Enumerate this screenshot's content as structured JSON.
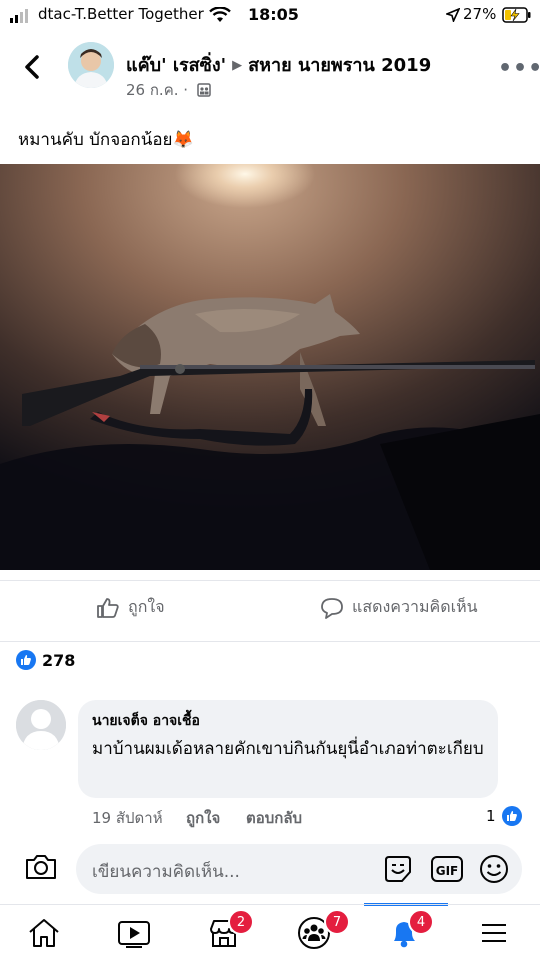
{
  "status_bar": {
    "carrier": "dtac-T.Better Together",
    "time": "18:05",
    "battery": "27%"
  },
  "header": {
    "author": "แค๊บ' เรสซิ่ง'",
    "group": "สหาย นายพราน 2019",
    "date": "26 ก.ค. ·",
    "colors": {
      "muted": "#65676b"
    }
  },
  "post": {
    "text": "หมานคับ บักจอกน้อย",
    "emoji": "🦊",
    "image_icon": "dead-fox-with-rifle-photo"
  },
  "actions": {
    "like_label": "ถูกใจ",
    "comment_label": "แสดงความคิดเห็น"
  },
  "reactions": {
    "count": "278",
    "icon": "like-icon"
  },
  "comment": {
    "author": "นายเจต็จ อาจเชื้อ",
    "text": "มาบ้านผมเด้อหลายคักเขาบ่กินกันยุนี่อำเภอท่าตะเกียบ",
    "time": "19 สัปดาห์",
    "like_label": "ถูกใจ",
    "reply_label": "ตอบกลับ",
    "like_count": "1"
  },
  "composer": {
    "placeholder": "เขียนความคิดเห็น..."
  },
  "nav": {
    "badges": {
      "marketplace": "2",
      "groups": "7",
      "notifications": "4"
    },
    "accent": "#1877f2",
    "badge_color": "#e41e3f"
  }
}
